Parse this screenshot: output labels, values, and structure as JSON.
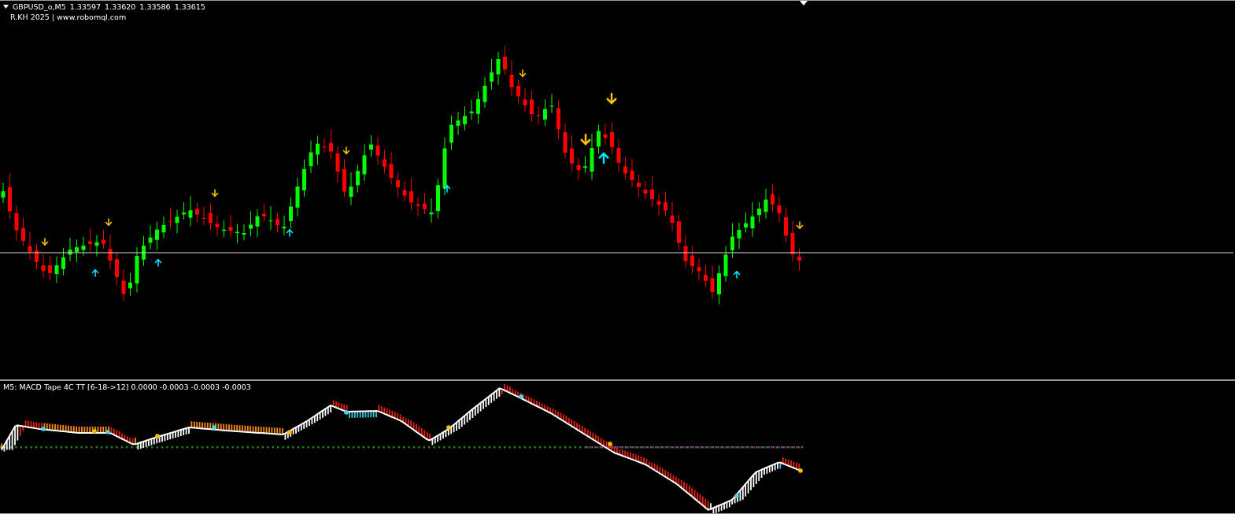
{
  "chart": {
    "symbol": "GBPUSD_o,M5",
    "quotes": [
      "1.33597",
      "1.33620",
      "1.33586",
      "1.33615"
    ],
    "credit": "R.KH 2025 | www.robomql.com"
  },
  "indicator": {
    "label": "M5: MACD Tape 4C TT [6-18->12] 0.0000 -0.0003 -0.0003 -0.0003"
  }
}
